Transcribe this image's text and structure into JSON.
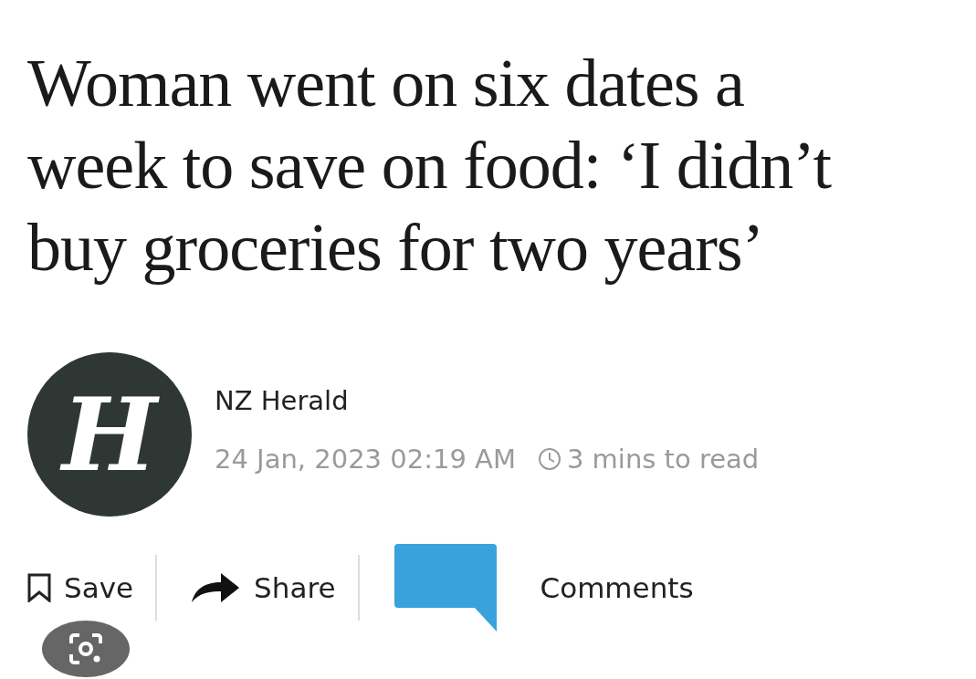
{
  "headline": "Woman went on six dates a week to save on food: ‘I didn’t buy groceries for two years’",
  "source": {
    "logo_letter": "H",
    "name": "NZ Herald",
    "date": "24 Jan, 2023 02:19 AM",
    "read_time": "3 mins to read"
  },
  "actions": [
    {
      "kind": "save",
      "label": "Save"
    },
    {
      "kind": "share",
      "label": "Share"
    },
    {
      "kind": "comments",
      "label": "Comments"
    }
  ]
}
